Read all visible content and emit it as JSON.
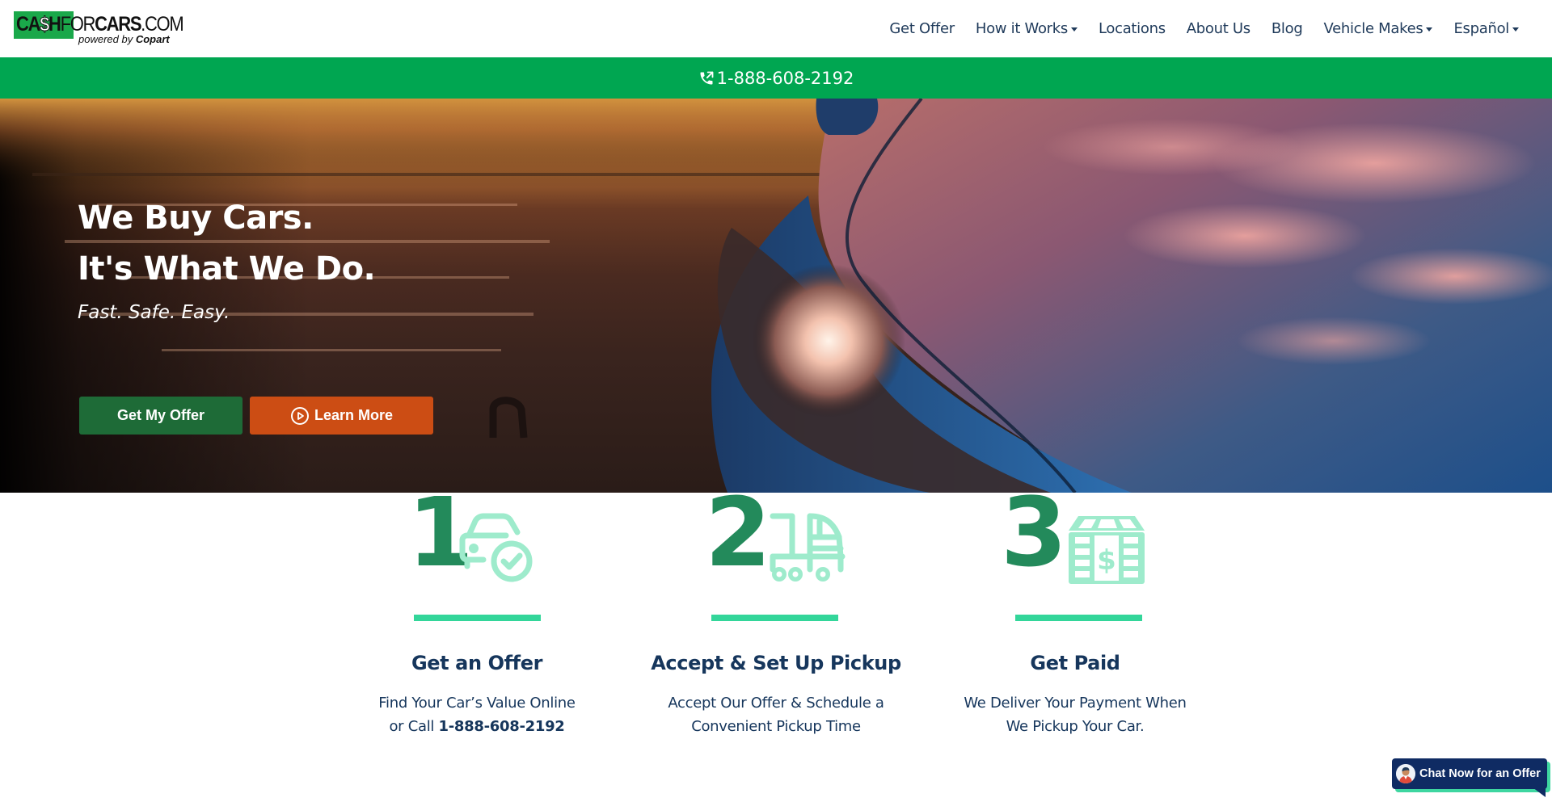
{
  "logo": {
    "part1": "CA",
    "dollar": "$",
    "part2": "H",
    "part3": "FOR",
    "part4": "CARS",
    "part5": ".COM",
    "sub_prefix": "powered by ",
    "sub_brand": "Copart"
  },
  "nav": {
    "items": [
      {
        "label": "Get Offer",
        "dropdown": false
      },
      {
        "label": "How it Works",
        "dropdown": true
      },
      {
        "label": "Locations",
        "dropdown": false
      },
      {
        "label": "About Us",
        "dropdown": false
      },
      {
        "label": "Blog",
        "dropdown": false
      },
      {
        "label": "Vehicle Makes",
        "dropdown": true
      },
      {
        "label": "Español",
        "dropdown": true
      }
    ]
  },
  "phone_bar": {
    "icon": "phone-outgoing-icon",
    "number": "1-888-608-2192"
  },
  "hero": {
    "headline_1": "We Buy Cars.",
    "headline_2": "It's What We Do.",
    "tagline": "Fast. Safe. Easy.",
    "primary_button": "Get My Offer",
    "secondary_button": "Learn More",
    "secondary_icon": "play-circle-icon"
  },
  "steps": [
    {
      "number": "1",
      "icon": "car-check-icon",
      "title": "Get an Offer",
      "desc_line1": "Find Your Car’s Value Online",
      "desc_line2_prefix": "or Call ",
      "desc_line2_bold": "1-888-608-2192"
    },
    {
      "number": "2",
      "icon": "tow-truck-icon",
      "title": "Accept & Set Up Pickup",
      "desc_line1": "Accept Our Offer & Schedule a",
      "desc_line2_prefix": "Convenient Pickup Time",
      "desc_line2_bold": ""
    },
    {
      "number": "3",
      "icon": "money-stack-icon",
      "title": "Get Paid",
      "desc_line1": "We Deliver Your Payment When",
      "desc_line2_prefix": "We Pickup Your Car.",
      "desc_line2_bold": ""
    }
  ],
  "chat": {
    "label": "Chat Now for an Offer",
    "icon": "agent-avatar-icon"
  },
  "colors": {
    "brand_green": "#00a651",
    "offer_button": "#1e6b37",
    "learn_button": "#cc4d14",
    "step_number": "#238a5b",
    "step_accent": "#33d69a",
    "step_icon": "#9eebcc",
    "text_navy": "#16365c",
    "chat_navy": "#0f2b63"
  }
}
